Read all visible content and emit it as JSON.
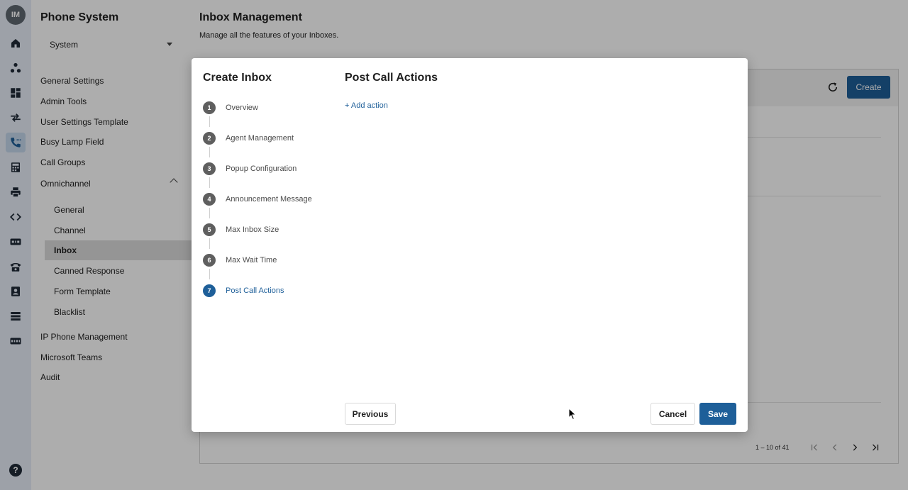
{
  "rail": {
    "avatar_initials": "IM",
    "help_label": "?",
    "icons": [
      "home-icon",
      "org-chart-icon",
      "dashboard-icon",
      "transfer-arrows-icon",
      "phone-settings-icon",
      "calculator-icon",
      "printer-icon",
      "code-icon",
      "sip-icon",
      "desk-phone-icon",
      "contacts-icon",
      "server-icon",
      "sip-trunk-icon"
    ]
  },
  "sidebar": {
    "title": "Phone System",
    "select_value": "System",
    "items": [
      {
        "label": "General Settings"
      },
      {
        "label": "Admin Tools"
      },
      {
        "label": "User Settings Template"
      },
      {
        "label": "Busy Lamp Field"
      },
      {
        "label": "Call Groups"
      },
      {
        "label": "Omnichannel"
      }
    ],
    "omnichannel_sub": [
      {
        "label": "General"
      },
      {
        "label": "Channel"
      },
      {
        "label": "Inbox"
      },
      {
        "label": "Canned Response"
      },
      {
        "label": "Form Template"
      },
      {
        "label": "Blacklist"
      }
    ],
    "items_after": [
      {
        "label": "IP Phone Management"
      },
      {
        "label": "Microsoft Teams"
      },
      {
        "label": "Audit"
      }
    ]
  },
  "page": {
    "title": "Inbox Management",
    "subtitle": "Manage all the features of your Inboxes.",
    "create_label": "Create",
    "pager_text": "1 – 10 of 41"
  },
  "modal": {
    "title": "Create Inbox",
    "steps": [
      {
        "num": "1",
        "label": "Overview"
      },
      {
        "num": "2",
        "label": "Agent Management"
      },
      {
        "num": "3",
        "label": "Popup Configuration"
      },
      {
        "num": "4",
        "label": "Announcement Message"
      },
      {
        "num": "5",
        "label": "Max Inbox Size"
      },
      {
        "num": "6",
        "label": "Max Wait Time"
      },
      {
        "num": "7",
        "label": "Post Call Actions"
      }
    ],
    "active_step": 7,
    "section_title": "Post Call Actions",
    "add_action_label": "+ Add action",
    "previous_label": "Previous",
    "cancel_label": "Cancel",
    "save_label": "Save"
  },
  "colors": {
    "accent": "#1e5f99",
    "rail_bg": "#e7eef8",
    "step_inactive": "#5f5f5f"
  }
}
